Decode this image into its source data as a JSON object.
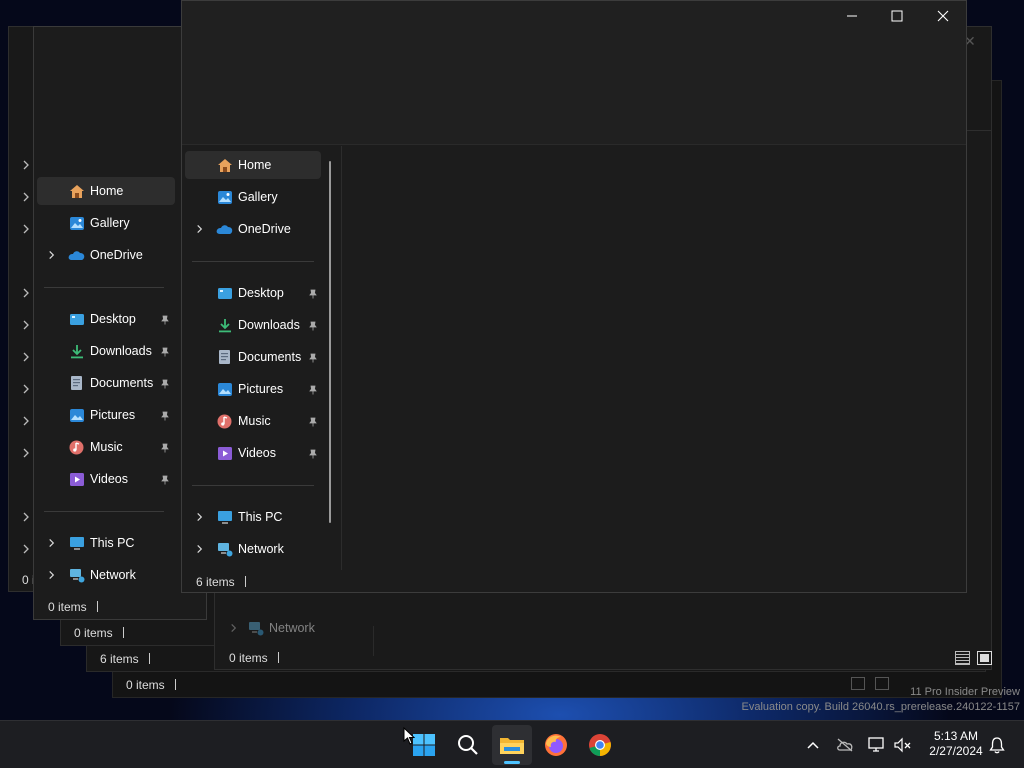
{
  "nav": {
    "home": "Home",
    "gallery": "Gallery",
    "onedrive": "OneDrive",
    "desktop": "Desktop",
    "downloads": "Downloads",
    "documents": "Documents",
    "pictures": "Pictures",
    "music": "Music",
    "videos": "Videos",
    "this_pc": "This PC",
    "network": "Network"
  },
  "status": {
    "items_6": "6 items",
    "items_0": "0 items",
    "items_0_short": "0 i"
  },
  "watermark": {
    "line1": "11 Pro Insider Preview",
    "line2": "Evaluation copy. Build 26040.rs_prerelease.240122-1157"
  },
  "clock": {
    "time": "5:13 AM",
    "date": "2/27/2024"
  },
  "icons": {
    "start": "windows-logo-icon",
    "search": "search-icon",
    "explorer": "file-explorer-icon",
    "firefox": "firefox-icon",
    "chrome": "chrome-icon",
    "tray_chevron": "chevron-up-icon",
    "cloud": "onedrive-offline-icon",
    "network": "network-icon",
    "volume": "volume-muted-icon",
    "bell": "notification-bell-icon"
  },
  "colors": {
    "window_bg": "#1c1c1c",
    "selected": "#2d2d2d",
    "taskbar": "#1d1e22",
    "accent": "#0078d4"
  }
}
